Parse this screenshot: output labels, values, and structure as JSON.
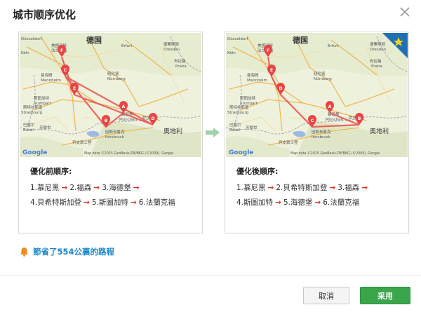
{
  "dialog": {
    "title": "城市顺序优化",
    "close_icon": "close-icon"
  },
  "panels": [
    {
      "caption": "優化前順序:",
      "route": [
        {
          "label": "1.慕尼黑"
        },
        {
          "label": "2.福森"
        },
        {
          "label": "3.海德堡"
        },
        {
          "label": "4.貝希特斯加登"
        },
        {
          "label": "5.斯圖加特"
        },
        {
          "label": "6.法蘭克福"
        }
      ]
    },
    {
      "caption": "優化後順序:",
      "route": [
        {
          "label": "1.慕尼黑"
        },
        {
          "label": "2.貝希特斯加登"
        },
        {
          "label": "3.福森"
        },
        {
          "label": "4.斯圖加特"
        },
        {
          "label": "5.海德堡"
        },
        {
          "label": "6.法蘭克福"
        }
      ]
    }
  ],
  "map_labels": {
    "germany": "德国",
    "austria": "奥地利",
    "google": "Google",
    "attribution": "Map data ©2015 GeoBasis-DE/BKG (©2009), Google",
    "cities": [
      "Düsseldorf",
      "美國河畔",
      "法兰克福",
      "Köln",
      "Erfurt",
      "德累斯顿",
      "Dresden",
      "布拉格",
      "Praha",
      "曼海姆",
      "Mannheim",
      "纽伦堡",
      "Nürnberg",
      "斯图加特",
      "Stuttgart",
      "斯特拉斯堡",
      "Strasbourg",
      "慕尼黑",
      "München",
      "萨尔茨堡",
      "巴塞尔",
      "Basel",
      "苏黎世",
      "因斯布鲁克",
      "Innsbruck",
      "列支敦士登"
    ],
    "marker_letters": [
      "A",
      "B",
      "C",
      "D",
      "E",
      "F"
    ]
  },
  "saving_text": "節省了554公裏的路程",
  "buttons": {
    "cancel": "取消",
    "apply": "采用"
  },
  "colors": {
    "apply_green": "#3aa54a",
    "link_blue": "#1b86c9",
    "route_red": "#e84545",
    "badge_blue": "#1f6fb5",
    "star_yellow": "#f4d21f"
  }
}
